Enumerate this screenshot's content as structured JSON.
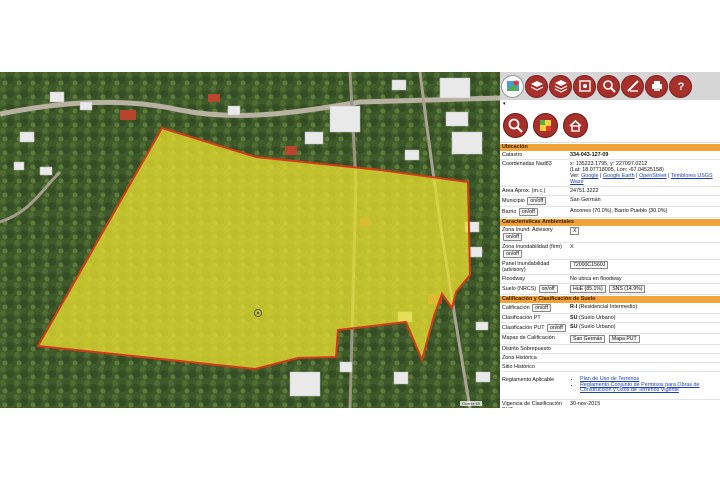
{
  "colors": {
    "parcel_fill": "#e5dc2f",
    "parcel_stroke": "#d33a1a",
    "section_header": "#f0a43a",
    "toolbar_bg": "#d6d6d6",
    "button_red": "#a8302a"
  },
  "map": {
    "scale_label": "Guerra 65"
  },
  "toolbar": {
    "icons": [
      "layers-map-icon",
      "layers-stack-icon",
      "layers-stack-icon",
      "identify-icon",
      "zoom-icon",
      "measure-icon",
      "print-icon",
      "help-icon"
    ],
    "dropdown_caret": "▾"
  },
  "tools": [
    "search-location-icon",
    "zoning-map-icon",
    "home-parcel-icon"
  ],
  "ubicacion": {
    "header": "Ubicación",
    "catastro_label": "Catastro",
    "catastro_value": "334-043-127-09",
    "coord_label": "Coordenadas Nad83",
    "coord_line1": "x: 135223.1795, y: 227097.0212",
    "coord_line2": "(Lat: 18.07718005, Lon: -67.04525158)",
    "ver_label": "Ver:",
    "links": [
      "Google",
      "Google Earth",
      "OpenStreet",
      "Temblores USGS",
      "Waze"
    ],
    "area_label": "Area Aprox. (m.c.)",
    "area_value": "24751.3222",
    "municipio_label": "Municipio",
    "municipio_value": "San Germán",
    "barrio_label": "Barrio",
    "barrio_value": "Ancones (70.0%), Barrio Pueblo (30.0%)",
    "onoff": "on/off"
  },
  "ambientales": {
    "header": "Características Ambientales",
    "zona_advisory_label": "Zona Inund. Advisory",
    "zona_advisory_value": "X",
    "zona_firm_label": "Zona Inundabilidad (firm)",
    "zona_firm_value": "X",
    "panel_label": "Panel Inundabilidad (advisory)",
    "panel_value": "72000C1560J",
    "floodway_label": "Floodway",
    "floodway_value": "No ubica en floodway",
    "suelo_label": "Suelo (NRCS)",
    "suelo_values": [
      "HuE (85.1%)",
      "SNS (14.9%)"
    ]
  },
  "calificacion": {
    "header": "Calificación y Clasificación de Suelo",
    "calif_label": "Calificación",
    "calif_code": "R-I",
    "calif_desc": "(Residencial Intermedio)",
    "clas_pt_label": "Clasificación PT",
    "clas_pt_code": "SU",
    "clas_pt_desc": "(Suelo Urbano)",
    "clas_put_label": "Clasificación PUT",
    "clas_put_code": "SU",
    "clas_put_desc": "(Suelo Urbano)",
    "mapas_label": "Mapas de Calificación",
    "mapas_buttons": [
      "San Germán",
      "Mapa PUT"
    ],
    "distrito_label": "Distrito Sobrepuesto",
    "zona_historica_label": "Zona Histórica",
    "sitio_historico_label": "Sitio Histórico",
    "reglamento_label": "Reglamento Aplicable",
    "reglamento_links": [
      "Plan de Uso de Terrenos",
      "Reglamento Conjunto de Permisos para Obras de Construcción y Usos de Terrenos Vigente"
    ],
    "vigencia_label": "Vigencia de Clasificación PUT",
    "vigencia_value": "30-nov-2015"
  }
}
